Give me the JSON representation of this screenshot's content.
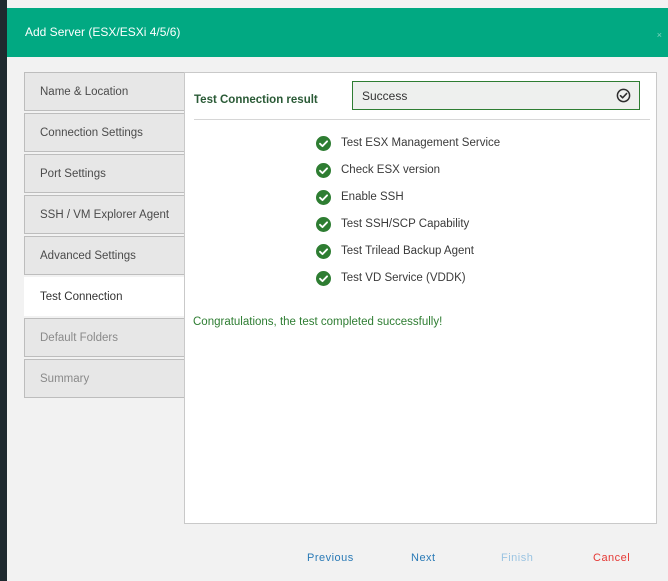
{
  "window": {
    "title": "Add Server (ESX/ESXi 4/5/6)",
    "close_glyph": "×"
  },
  "sidebar": {
    "items": [
      {
        "label": "Name & Location",
        "state": "normal"
      },
      {
        "label": "Connection Settings",
        "state": "normal"
      },
      {
        "label": "Port Settings",
        "state": "normal"
      },
      {
        "label": "SSH / VM Explorer Agent",
        "state": "normal"
      },
      {
        "label": "Advanced Settings",
        "state": "normal"
      },
      {
        "label": "Test Connection",
        "state": "active"
      },
      {
        "label": "Default Folders",
        "state": "disabled"
      },
      {
        "label": "Summary",
        "state": "disabled"
      }
    ]
  },
  "main": {
    "result_label": "Test Connection result",
    "result_value": "Success",
    "checks": [
      {
        "label": "Test ESX Management Service",
        "icon": "check-circle-icon"
      },
      {
        "label": "Check ESX version",
        "icon": "check-circle-icon"
      },
      {
        "label": "Enable SSH",
        "icon": "check-circle-icon"
      },
      {
        "label": "Test SSH/SCP Capability",
        "icon": "check-circle-icon"
      },
      {
        "label": "Test Trilead Backup Agent",
        "icon": "check-circle-icon"
      },
      {
        "label": "Test VD Service (VDDK)",
        "icon": "check-circle-icon"
      }
    ],
    "message": "Congratulations, the test completed successfully!"
  },
  "footer": {
    "previous": "Previous",
    "next": "Next",
    "finish": "Finish",
    "cancel": "Cancel"
  },
  "colors": {
    "accent": "#01a982",
    "success": "#2e7d32",
    "link": "#2a7ab6",
    "danger": "#e53935"
  }
}
